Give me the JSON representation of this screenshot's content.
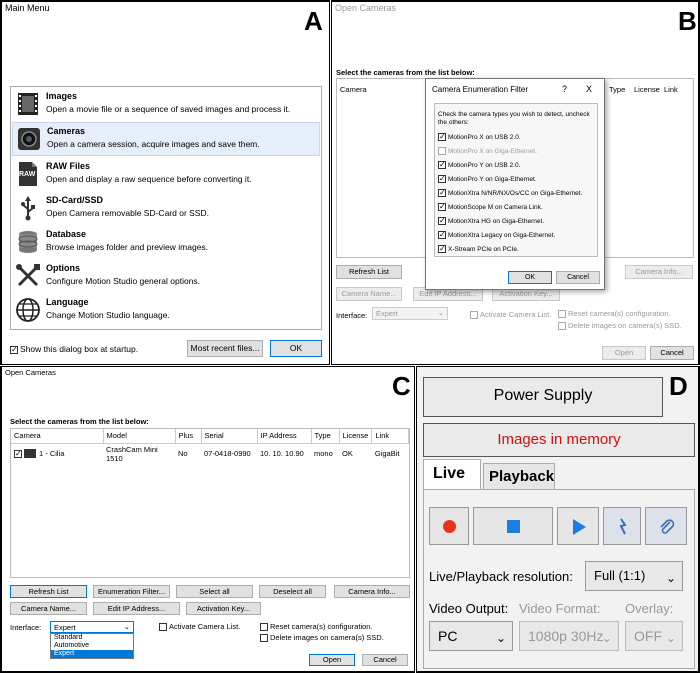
{
  "labels": {
    "a": "A",
    "b": "B",
    "c": "C",
    "d": "D"
  },
  "a": {
    "title": "Main Menu",
    "items": [
      {
        "title": "Images",
        "desc": "Open a movie file or a sequence of saved images and process it.",
        "icon": "film-icon"
      },
      {
        "title": "Cameras",
        "desc": "Open a camera session, acquire images and save them.",
        "icon": "camera-icon"
      },
      {
        "title": "RAW Files",
        "desc": "Open and display a raw sequence before converting it.",
        "icon": "raw-file-icon",
        "badge": "RAW"
      },
      {
        "title": "SD-Card/SSD",
        "desc": "Open Camera removable SD-Card or SSD.",
        "icon": "usb-icon"
      },
      {
        "title": "Database",
        "desc": "Browse images folder and preview images.",
        "icon": "database-icon"
      },
      {
        "title": "Options",
        "desc": "Configure Motion Studio general options.",
        "icon": "tools-icon"
      },
      {
        "title": "Language",
        "desc": "Change Motion Studio language.",
        "icon": "globe-icon"
      }
    ],
    "show_startup": "Show this dialog box at startup.",
    "recent": "Most recent files...",
    "ok": "OK"
  },
  "b": {
    "title": "Open Cameras",
    "select_label": "Select the cameras from the list below:",
    "cols": {
      "camera": "Camera",
      "type": "Type",
      "license": "License",
      "link": "Link"
    },
    "refresh": "Refresh List",
    "camera_info": "Camera Info...",
    "camera_name": "Camera Name...",
    "edit_ip": "Edit IP Address...",
    "activation": "Activation Key...",
    "interface_label": "Interface:",
    "interface_value": "Expert",
    "activate": "Activate Camera List.",
    "reset": "Reset camera(s) configuration.",
    "delete": "Delete images on camera(s) SSD.",
    "open": "Open",
    "cancel": "Cancel",
    "dialog": {
      "title": "Camera Enumeration Filter",
      "help": "?",
      "close": "X",
      "instructions": "Check the camera types you wish to detect, uncheck the others:",
      "ok": "OK",
      "cancel": "Cancel",
      "options": [
        {
          "label": "MotionPro X on USB 2.0.",
          "checked": true,
          "disabled": false
        },
        {
          "label": "MotionPro X on Giga-Ethernet.",
          "checked": false,
          "disabled": true
        },
        {
          "label": "MotionPro Y on USB 2.0.",
          "checked": true,
          "disabled": false
        },
        {
          "label": "MotionPro Y on Giga-Ethernet.",
          "checked": true,
          "disabled": false
        },
        {
          "label": "MotionXtra N/NR/NX/Os/CC on Giga-Ethernet.",
          "checked": true,
          "disabled": false
        },
        {
          "label": "MotionScope M on Camera Link.",
          "checked": true,
          "disabled": false
        },
        {
          "label": "MotionXtra HG on Giga-Ethernet.",
          "checked": true,
          "disabled": false
        },
        {
          "label": "MotionXtra Legacy on Giga-Ethernet.",
          "checked": true,
          "disabled": false
        },
        {
          "label": "X-Stream PCIe on PCIe.",
          "checked": true,
          "disabled": false
        }
      ]
    }
  },
  "c": {
    "title": "Open Cameras",
    "select_label": "Select the cameras from the list below:",
    "cols": [
      "Camera",
      "Model",
      "Plus",
      "Serial",
      "IP Address",
      "Type",
      "License",
      "Link"
    ],
    "rows": [
      [
        "1 - Cilia",
        "CrashCam Mini 1510",
        "No",
        "07-0418-0990",
        "10. 10. 10.90",
        "mono",
        "OK",
        "GigaBit"
      ]
    ],
    "refresh": "Refresh List",
    "enum": "Enumeration Filter...",
    "select_all": "Select all",
    "deselect_all": "Deselect all",
    "camera_info": "Camera Info...",
    "camera_name": "Camera Name...",
    "edit_ip": "Edit IP Address...",
    "activation": "Activation Key...",
    "interface_label": "Interface:",
    "interface_value": "Expert",
    "options": [
      "Standard",
      "Automotive",
      "Expert"
    ],
    "activate": "Activate Camera List.",
    "reset": "Reset camera(s) configuration.",
    "delete": "Delete images on camera(s) SSD.",
    "open": "Open",
    "cancel": "Cancel"
  },
  "d": {
    "power": "Power Supply",
    "memory": "Images in memory",
    "tab_live": "Live",
    "tab_playback": "Playback",
    "res_label": "Live/Playback resolution:",
    "res_value": "Full (1:1)",
    "video_output": "Video Output:",
    "video_format": "Video Format:",
    "overlay": "Overlay:",
    "output_value": "PC",
    "format_value": "1080p 30Hz",
    "overlay_value": "OFF",
    "colors": {
      "record": "#e8341a",
      "blue": "#1a7fe0",
      "memory": "#d01010"
    }
  }
}
